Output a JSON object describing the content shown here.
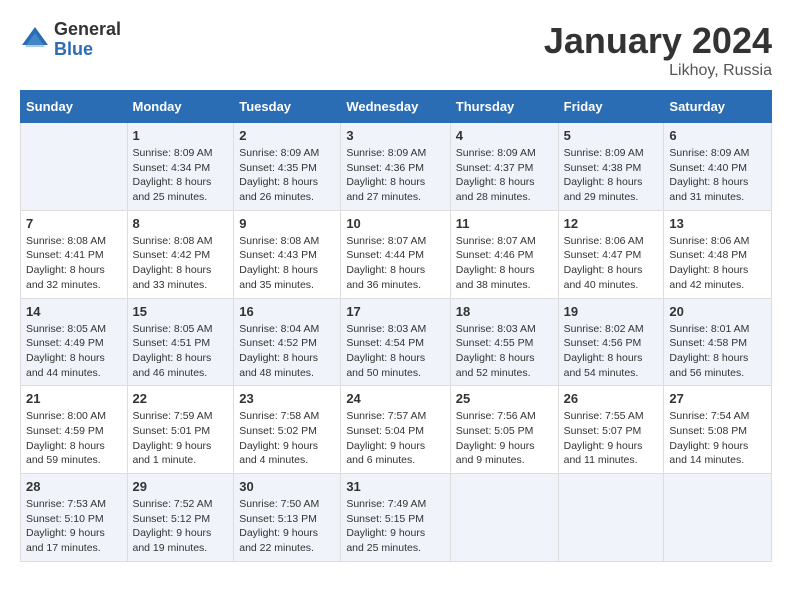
{
  "logo": {
    "general": "General",
    "blue": "Blue"
  },
  "title": "January 2024",
  "location": "Likhoy, Russia",
  "days_of_week": [
    "Sunday",
    "Monday",
    "Tuesday",
    "Wednesday",
    "Thursday",
    "Friday",
    "Saturday"
  ],
  "weeks": [
    [
      {
        "day": "",
        "info": ""
      },
      {
        "day": "1",
        "info": "Sunrise: 8:09 AM\nSunset: 4:34 PM\nDaylight: 8 hours\nand 25 minutes."
      },
      {
        "day": "2",
        "info": "Sunrise: 8:09 AM\nSunset: 4:35 PM\nDaylight: 8 hours\nand 26 minutes."
      },
      {
        "day": "3",
        "info": "Sunrise: 8:09 AM\nSunset: 4:36 PM\nDaylight: 8 hours\nand 27 minutes."
      },
      {
        "day": "4",
        "info": "Sunrise: 8:09 AM\nSunset: 4:37 PM\nDaylight: 8 hours\nand 28 minutes."
      },
      {
        "day": "5",
        "info": "Sunrise: 8:09 AM\nSunset: 4:38 PM\nDaylight: 8 hours\nand 29 minutes."
      },
      {
        "day": "6",
        "info": "Sunrise: 8:09 AM\nSunset: 4:40 PM\nDaylight: 8 hours\nand 31 minutes."
      }
    ],
    [
      {
        "day": "7",
        "info": "Sunrise: 8:08 AM\nSunset: 4:41 PM\nDaylight: 8 hours\nand 32 minutes."
      },
      {
        "day": "8",
        "info": "Sunrise: 8:08 AM\nSunset: 4:42 PM\nDaylight: 8 hours\nand 33 minutes."
      },
      {
        "day": "9",
        "info": "Sunrise: 8:08 AM\nSunset: 4:43 PM\nDaylight: 8 hours\nand 35 minutes."
      },
      {
        "day": "10",
        "info": "Sunrise: 8:07 AM\nSunset: 4:44 PM\nDaylight: 8 hours\nand 36 minutes."
      },
      {
        "day": "11",
        "info": "Sunrise: 8:07 AM\nSunset: 4:46 PM\nDaylight: 8 hours\nand 38 minutes."
      },
      {
        "day": "12",
        "info": "Sunrise: 8:06 AM\nSunset: 4:47 PM\nDaylight: 8 hours\nand 40 minutes."
      },
      {
        "day": "13",
        "info": "Sunrise: 8:06 AM\nSunset: 4:48 PM\nDaylight: 8 hours\nand 42 minutes."
      }
    ],
    [
      {
        "day": "14",
        "info": "Sunrise: 8:05 AM\nSunset: 4:49 PM\nDaylight: 8 hours\nand 44 minutes."
      },
      {
        "day": "15",
        "info": "Sunrise: 8:05 AM\nSunset: 4:51 PM\nDaylight: 8 hours\nand 46 minutes."
      },
      {
        "day": "16",
        "info": "Sunrise: 8:04 AM\nSunset: 4:52 PM\nDaylight: 8 hours\nand 48 minutes."
      },
      {
        "day": "17",
        "info": "Sunrise: 8:03 AM\nSunset: 4:54 PM\nDaylight: 8 hours\nand 50 minutes."
      },
      {
        "day": "18",
        "info": "Sunrise: 8:03 AM\nSunset: 4:55 PM\nDaylight: 8 hours\nand 52 minutes."
      },
      {
        "day": "19",
        "info": "Sunrise: 8:02 AM\nSunset: 4:56 PM\nDaylight: 8 hours\nand 54 minutes."
      },
      {
        "day": "20",
        "info": "Sunrise: 8:01 AM\nSunset: 4:58 PM\nDaylight: 8 hours\nand 56 minutes."
      }
    ],
    [
      {
        "day": "21",
        "info": "Sunrise: 8:00 AM\nSunset: 4:59 PM\nDaylight: 8 hours\nand 59 minutes."
      },
      {
        "day": "22",
        "info": "Sunrise: 7:59 AM\nSunset: 5:01 PM\nDaylight: 9 hours\nand 1 minute."
      },
      {
        "day": "23",
        "info": "Sunrise: 7:58 AM\nSunset: 5:02 PM\nDaylight: 9 hours\nand 4 minutes."
      },
      {
        "day": "24",
        "info": "Sunrise: 7:57 AM\nSunset: 5:04 PM\nDaylight: 9 hours\nand 6 minutes."
      },
      {
        "day": "25",
        "info": "Sunrise: 7:56 AM\nSunset: 5:05 PM\nDaylight: 9 hours\nand 9 minutes."
      },
      {
        "day": "26",
        "info": "Sunrise: 7:55 AM\nSunset: 5:07 PM\nDaylight: 9 hours\nand 11 minutes."
      },
      {
        "day": "27",
        "info": "Sunrise: 7:54 AM\nSunset: 5:08 PM\nDaylight: 9 hours\nand 14 minutes."
      }
    ],
    [
      {
        "day": "28",
        "info": "Sunrise: 7:53 AM\nSunset: 5:10 PM\nDaylight: 9 hours\nand 17 minutes."
      },
      {
        "day": "29",
        "info": "Sunrise: 7:52 AM\nSunset: 5:12 PM\nDaylight: 9 hours\nand 19 minutes."
      },
      {
        "day": "30",
        "info": "Sunrise: 7:50 AM\nSunset: 5:13 PM\nDaylight: 9 hours\nand 22 minutes."
      },
      {
        "day": "31",
        "info": "Sunrise: 7:49 AM\nSunset: 5:15 PM\nDaylight: 9 hours\nand 25 minutes."
      },
      {
        "day": "",
        "info": ""
      },
      {
        "day": "",
        "info": ""
      },
      {
        "day": "",
        "info": ""
      }
    ]
  ]
}
